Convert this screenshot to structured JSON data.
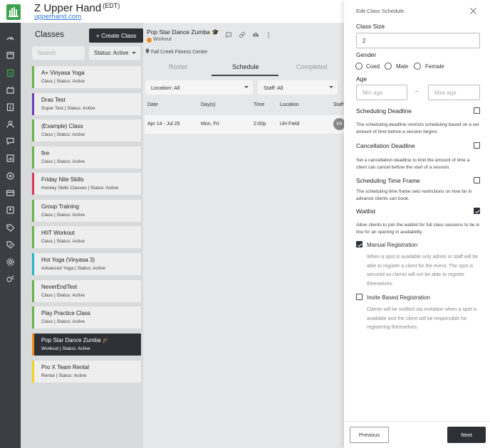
{
  "app": {
    "name": "Z Upper Hand",
    "timezone": "(EDT)",
    "site_link": "upperhand.com",
    "brand_color": "#3aa34c"
  },
  "rail_icons": [
    "dashboard-icon",
    "calendar-icon",
    "classes-icon",
    "events-icon",
    "invoice-icon",
    "clients-icon",
    "messages-icon",
    "reports-icon",
    "marketing-icon",
    "memberships-icon",
    "contacts-icon",
    "tags-icon",
    "discounts-icon",
    "settings-icon",
    "integrations-icon"
  ],
  "class_panel": {
    "heading": "Classes",
    "create_label": "+ Create Class",
    "search_placeholder": "Search",
    "status_filter": "Status: Active",
    "items": [
      {
        "name": "A+ Vinyasa Yoga",
        "sub": "Class | Status: Active",
        "color": "#6ab04c"
      },
      {
        "name": "Dras Test",
        "sub": "Super Test | Status: Active",
        "color": "#6f3fb6"
      },
      {
        "name": "(Example) Class",
        "sub": "Class | Status: Active",
        "color": "#6ab04c"
      },
      {
        "name": "fire",
        "sub": "Class | Status: Active",
        "color": "#6ab04c"
      },
      {
        "name": "Friday Nite Skills",
        "sub": "Hockey Skills Classes | Status: Active",
        "color": "#d9385e"
      },
      {
        "name": "Group Training",
        "sub": "Class | Status: Active",
        "color": "#6ab04c"
      },
      {
        "name": "HIIT Workout",
        "sub": "Class | Status: Active",
        "color": "#6ab04c"
      },
      {
        "name": "Hot Yoga (Vinyasa 3)",
        "sub": "Advanced Yoga | Status: Active",
        "color": "#2bb3c9"
      },
      {
        "name": "NeverEndTest",
        "sub": "Class | Status: Active",
        "color": "#6ab04c"
      },
      {
        "name": "Play Practice Class",
        "sub": "Class | Status: Active",
        "color": "#6ab04c"
      },
      {
        "name": "Pop Star Dance Zumba 🎓",
        "sub": "Workout | Status: Active",
        "color": "#f28c1b",
        "selected": true
      },
      {
        "name": "Pro X Team Rental",
        "sub": "Rental | Status: Active",
        "color": "#f2d21b"
      }
    ]
  },
  "detail": {
    "class_title": "Pop Star Dance Zumba 🎓",
    "type_label": "Workout",
    "type_color": "#f28c1b",
    "location": "Fall Creek Fitness Center",
    "tabs": [
      "Roster",
      "Schedule",
      "Completed"
    ],
    "active_tab": "Schedule",
    "location_filter": "Location: All",
    "staff_filter": "Staff: All",
    "columns": [
      "Date",
      "Day(s)",
      "Time",
      "Location",
      "Staff"
    ],
    "row": {
      "date": "Apr 14 - Jul 25",
      "days": "Mon, Fri",
      "time": "2:00p",
      "location": "UH Field",
      "staff_initials": "KR"
    }
  },
  "drawer": {
    "title": "Edit Class Schedule",
    "class_size_label": "Class Size",
    "class_size_value": "2",
    "gender_label": "Gender",
    "gender_options": [
      "Coed",
      "Male",
      "Female"
    ],
    "age_label": "Age",
    "min_age_placeholder": "Min age",
    "max_age_placeholder": "Max age",
    "age_separator": "–",
    "scheduling_deadline": {
      "title": "Scheduling Deadline",
      "desc": "The scheduling deadline restricts scheduling based on a set amount of time before a session begins.",
      "checked": false
    },
    "cancellation_deadline": {
      "title": "Cancellation Deadline",
      "desc": "Set a cancellation deadline to limit the amount of time a client can cancel before the start of a session.",
      "checked": false
    },
    "scheduling_time_frame": {
      "title": "Scheduling Time Frame",
      "desc": "The scheduling time frame sets restrictions on how far in advance clients can book.",
      "checked": false
    },
    "waitlist": {
      "title": "Waitlist",
      "desc": "Allow clients to join the waitlist for full class sessions to be in line for an opening in availability.",
      "checked": true
    },
    "manual_registration": {
      "title": "Manual Registration",
      "desc": "When a spot is available only admin or staff will be able to register a client for the event. The spot is secured so clients will not be able to register themselves.",
      "checked": true
    },
    "invite_registration": {
      "title": "Invite Based Registration",
      "desc": "Clients will be notified via invitation when a spot is available and the client will be responsible for registering themselves.",
      "checked": false
    },
    "previous_label": "Previous",
    "next_label": "Next"
  }
}
